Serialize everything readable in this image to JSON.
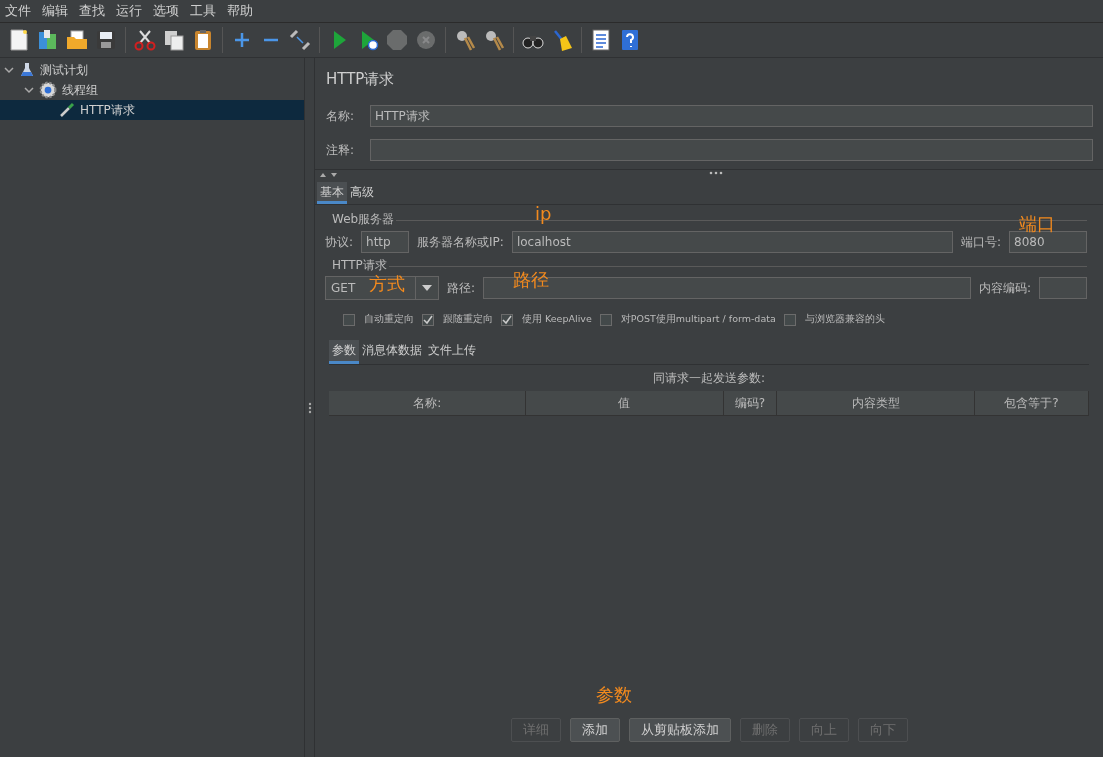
{
  "menu": [
    "文件",
    "编辑",
    "查找",
    "运行",
    "选项",
    "工具",
    "帮助"
  ],
  "toolbar": [
    [
      {
        "kind": "new",
        "disabled": false
      },
      {
        "kind": "templates",
        "disabled": false
      },
      {
        "kind": "open",
        "disabled": false
      },
      {
        "kind": "save",
        "disabled": false
      }
    ],
    [
      {
        "kind": "cut",
        "disabled": false
      },
      {
        "kind": "copy",
        "disabled": false
      },
      {
        "kind": "paste",
        "disabled": false
      }
    ],
    [
      {
        "kind": "add",
        "disabled": false
      },
      {
        "kind": "remove",
        "disabled": false
      },
      {
        "kind": "toggle",
        "disabled": false
      }
    ],
    [
      {
        "kind": "start",
        "disabled": false
      },
      {
        "kind": "start-nopause",
        "disabled": false
      },
      {
        "kind": "stop",
        "disabled": true
      },
      {
        "kind": "shutdown",
        "disabled": true
      }
    ],
    [
      {
        "kind": "clear",
        "disabled": false
      },
      {
        "kind": "clear-all",
        "disabled": false
      }
    ],
    [
      {
        "kind": "search",
        "disabled": false
      },
      {
        "kind": "reset",
        "disabled": false
      }
    ],
    [
      {
        "kind": "functions",
        "disabled": false
      },
      {
        "kind": "help",
        "disabled": false
      }
    ]
  ],
  "tree": [
    {
      "label": "测试计划",
      "kind": "plan",
      "expanded": true,
      "selected": false,
      "children": [
        {
          "label": "线程组",
          "kind": "group",
          "expanded": true,
          "selected": false,
          "children": [
            {
              "label": "HTTP请求",
              "kind": "sampler",
              "selected": true
            }
          ]
        }
      ]
    }
  ],
  "panel": {
    "title": "HTTP请求",
    "name_label": "名称:",
    "name_value": "HTTP请求",
    "comment_label": "注释:"
  },
  "tabs": [
    {
      "label": "基本",
      "selected": true
    },
    {
      "label": "高级",
      "selected": false
    }
  ],
  "web_server": {
    "legend": "Web服务器",
    "protocol_label": "协议:",
    "protocol": "http",
    "server_label": "服务器名称或IP:",
    "server": "localhost",
    "port_label": "端口号:",
    "port": "8080"
  },
  "http_request": {
    "legend": "HTTP请求",
    "method": "GET",
    "path_label": "路径:",
    "encoding_label": "内容编码:"
  },
  "options": [
    {
      "label": "自动重定向",
      "checked": false
    },
    {
      "label": "跟随重定向",
      "checked": true
    },
    {
      "label": "使用 KeepAlive",
      "checked": true
    },
    {
      "label": "对POST使用multipart / form-data",
      "checked": false
    },
    {
      "label": "与浏览器兼容的头",
      "checked": false
    }
  ],
  "sub_tabs": [
    {
      "label": "参数",
      "selected": true
    },
    {
      "label": "消息体数据",
      "selected": false
    },
    {
      "label": "文件上传",
      "selected": false
    }
  ],
  "table": {
    "caption": "同请求一起发送参数:",
    "columns": [
      "名称:",
      "值",
      "编码?",
      "内容类型",
      "包含等于?"
    ]
  },
  "buttons": [
    {
      "label": "详细",
      "disabled": true
    },
    {
      "label": "添加",
      "disabled": false
    },
    {
      "label": "从剪贴板添加",
      "disabled": false
    },
    {
      "label": "删除",
      "disabled": true
    },
    {
      "label": "向上",
      "disabled": true
    },
    {
      "label": "向下",
      "disabled": true
    }
  ],
  "annotations": [
    "ip",
    "端口",
    "方式",
    "路径",
    "参数"
  ]
}
